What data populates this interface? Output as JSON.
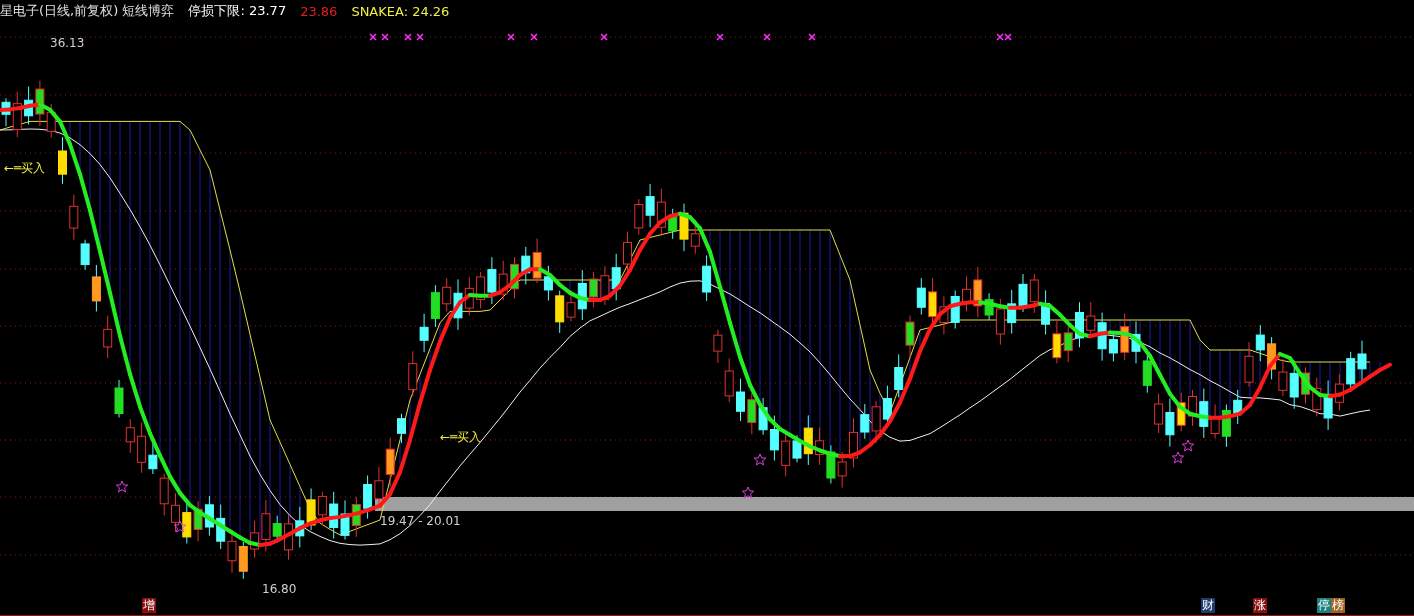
{
  "header": {
    "title": "星电子(日线,前复权) 短线博弈",
    "indicators": [
      {
        "label": "停损下限: 23.77",
        "color": "#ffffff"
      },
      {
        "label": "23.86",
        "color": "#e02020"
      },
      {
        "label": "SNAKEA: 24.26",
        "color": "#f0f040"
      }
    ]
  },
  "chart": {
    "annotations": [
      {
        "kind": "high",
        "text": "36.13"
      },
      {
        "kind": "buy",
        "text": "←═买入"
      },
      {
        "kind": "buy",
        "text": "←═买入"
      },
      {
        "kind": "range",
        "text": "19.47 - 20.01"
      },
      {
        "kind": "low",
        "text": "16.80"
      }
    ]
  },
  "bottom_tags": [
    {
      "parts": [
        {
          "text": "增",
          "color": "#8a1010"
        }
      ]
    },
    {
      "parts": [
        {
          "text": "财",
          "color": "#1c3c6c"
        }
      ]
    },
    {
      "parts": [
        {
          "text": "涨",
          "color": "#8a1010"
        }
      ]
    },
    {
      "parts": [
        {
          "text": "停",
          "color": "#1a8080"
        },
        {
          "text": "榜",
          "color": "#a06420"
        }
      ]
    }
  ]
}
